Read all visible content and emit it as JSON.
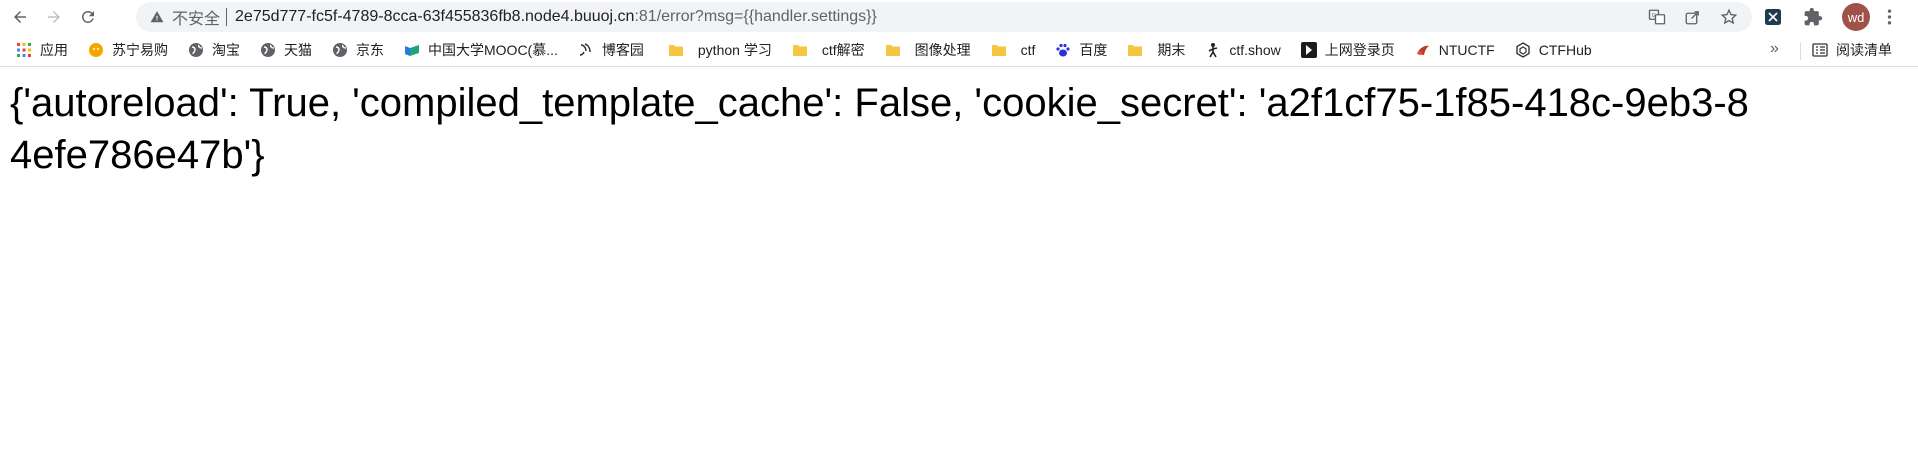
{
  "toolbar": {
    "security_label": "不安全",
    "url_host": "2e75d777-fc5f-4789-8cca-63f455836fb8.node4.buuoj.cn",
    "url_path": ":81/error?msg={{handler.settings}}",
    "avatar_initials": "wd"
  },
  "bookmarks": {
    "items": [
      {
        "label": "应用",
        "icon": "apps-grid-icon"
      },
      {
        "label": "苏宁易购",
        "icon": "suning-icon"
      },
      {
        "label": "淘宝",
        "icon": "globe-icon"
      },
      {
        "label": "天猫",
        "icon": "globe-icon"
      },
      {
        "label": "京东",
        "icon": "globe-icon"
      },
      {
        "label": "中国大学MOOC(慕...",
        "icon": "mooc-icon"
      },
      {
        "label": "博客园",
        "icon": "cnblogs-icon"
      },
      {
        "label": "python 学习",
        "icon": "folder-icon"
      },
      {
        "label": "ctf解密",
        "icon": "folder-icon"
      },
      {
        "label": "图像处理",
        "icon": "folder-icon"
      },
      {
        "label": "ctf",
        "icon": "folder-icon"
      },
      {
        "label": "百度",
        "icon": "baidu-icon"
      },
      {
        "label": "期末",
        "icon": "folder-icon"
      },
      {
        "label": "ctf.show",
        "icon": "ctfshow-icon"
      },
      {
        "label": "上网登录页",
        "icon": "login-page-icon"
      },
      {
        "label": "NTUCTF",
        "icon": "ntuctf-icon"
      },
      {
        "label": "CTFHub",
        "icon": "ctfhub-icon"
      }
    ],
    "overflow": "»",
    "reading_list": "阅读清单"
  },
  "page": {
    "body_text": "{'autoreload': True, 'compiled_template_cache': False, 'cookie_secret': 'a2f1cf75-1f85-418c-9eb3-84efe786e47b'}"
  },
  "colors": {
    "omnibox_bg": "#f1f3f4",
    "folder": "#f6c542",
    "avatar": "#a0524a"
  }
}
